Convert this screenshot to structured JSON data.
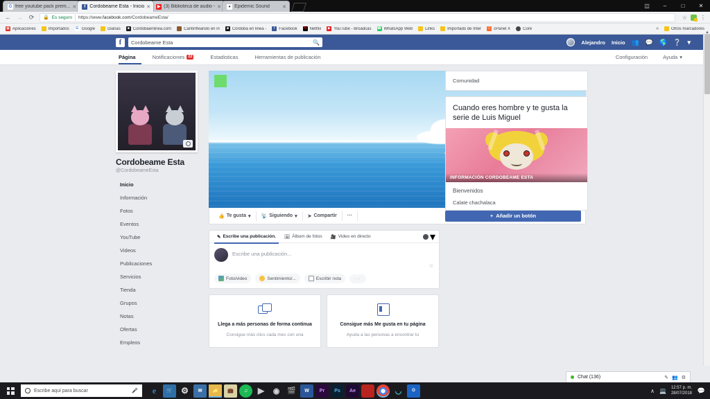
{
  "browser": {
    "tabs": [
      {
        "title": "free youtube pack prem...",
        "icon": "google-favicon",
        "active": false
      },
      {
        "title": "Cordobeame Esta - Inicio",
        "icon": "facebook-favicon",
        "active": true
      },
      {
        "title": "(3) Biblioteca de audio -",
        "icon": "youtube-favicon",
        "active": false
      },
      {
        "title": "Epidemic Sound",
        "icon": "epidemic-favicon",
        "active": false
      }
    ],
    "window_controls": [
      "minimize-restore",
      "minimize",
      "maximize",
      "close"
    ],
    "omnibox": {
      "secure_label": "Es seguro",
      "url_scheme": "https://www.",
      "url_host": "facebook.com",
      "url_path": "/CordobeameEsta/"
    },
    "bookmarks": [
      {
        "label": "Aplicaciones",
        "icon": "apps-grid-icon"
      },
      {
        "label": "Importados",
        "icon": "folder-icon"
      },
      {
        "label": "Google",
        "icon": "google-icon"
      },
      {
        "label": "Dianas",
        "icon": "folder-icon"
      },
      {
        "label": "Cordobaenlinea.com",
        "icon": "site-icon"
      },
      {
        "label": "Cantinfleando en in",
        "icon": "site-icon"
      },
      {
        "label": "Córdoba en linea -",
        "icon": "site-icon"
      },
      {
        "label": "Facebook",
        "icon": "facebook-icon"
      },
      {
        "label": "Netflix",
        "icon": "netflix-icon"
      },
      {
        "label": "YouTube - Broadcas",
        "icon": "youtube-icon"
      },
      {
        "label": "WhatsApp Web",
        "icon": "whatsapp-icon"
      },
      {
        "label": "Links",
        "icon": "folder-icon"
      },
      {
        "label": "Importado de Inter",
        "icon": "folder-icon"
      },
      {
        "label": "cPanel X",
        "icon": "cpanel-icon"
      },
      {
        "label": "Core",
        "icon": "core-icon"
      }
    ],
    "bookmarks_overflow": "»",
    "other_bookmarks": "Otros marcadores"
  },
  "facebook": {
    "topbar": {
      "logo": "f",
      "search_value": "Cordobeame Esta",
      "search_icon": "search-icon",
      "user_name": "Alejandro",
      "home_label": "Inicio",
      "icons": [
        "friend-requests-icon",
        "messenger-icon",
        "notifications-globe-icon",
        "help-icon",
        "account-chevron-icon"
      ]
    },
    "nav": {
      "items": [
        {
          "label": "Página",
          "active": true,
          "badge": null
        },
        {
          "label": "Notificaciones",
          "active": false,
          "badge": "22"
        },
        {
          "label": "Estadisticas",
          "active": false,
          "badge": null
        },
        {
          "label": "Herramientas de publicación",
          "active": false,
          "badge": null
        }
      ],
      "right_items": [
        {
          "label": "Configuración"
        },
        {
          "label": "Ayuda"
        }
      ]
    },
    "profile": {
      "page_name": "Cordobeame Esta",
      "handle": "@CordobeameEsta",
      "photo_camera_icon": "camera-icon"
    },
    "sidebar": [
      {
        "label": "Inicio",
        "active": true
      },
      {
        "label": "Información",
        "active": false
      },
      {
        "label": "Fotos",
        "active": false
      },
      {
        "label": "Eventos",
        "active": false
      },
      {
        "label": "YouTube",
        "active": false
      },
      {
        "label": "Videos",
        "active": false
      },
      {
        "label": "Publicaciones",
        "active": false
      },
      {
        "label": "Servicios",
        "active": false
      },
      {
        "label": "Tienda",
        "active": false
      },
      {
        "label": "Grupos",
        "active": false
      },
      {
        "label": "Notas",
        "active": false
      },
      {
        "label": "Ofertas",
        "active": false
      },
      {
        "label": "Empleos",
        "active": false
      }
    ],
    "actions": {
      "like": "Te gusta",
      "following": "Siguiendo",
      "share": "Compartir",
      "more": "···",
      "add_button": "Añadir un botón",
      "add_button_plus": "+"
    },
    "composer": {
      "tabs": [
        {
          "label": "Escribe una publicación.",
          "icon": "pencil-icon",
          "active": true
        },
        {
          "label": "Álbum de fotos",
          "icon": "photo-album-icon",
          "active": false
        },
        {
          "label": "Video en directo",
          "icon": "video-camera-icon",
          "active": false
        }
      ],
      "audience_icon": "globe-icon",
      "audience_chevron": "▾",
      "placeholder": "Escribe una publicación...",
      "emoji_icon": "emoji-icon",
      "actions": [
        {
          "label": "Foto/video",
          "icon": "photo-video-icon"
        },
        {
          "label": "Sentimiento/...",
          "icon": "feeling-icon"
        },
        {
          "label": "Escribir nota",
          "icon": "note-icon"
        },
        {
          "label": "···",
          "icon": "more-icon"
        }
      ]
    },
    "promos": [
      {
        "title": "Llega a más personas de forma continua",
        "desc": "Consigue más clics cada mes con una",
        "icon": "overlapping-squares-icon"
      },
      {
        "title": "Consigue más Me gusta en tu página",
        "desc": "Ayuda a las personas a encontrar tu",
        "icon": "page-layout-icon"
      }
    ],
    "right": {
      "community_title": "Comunidad",
      "post_title": "Cuando eres hombre y te gusta la serie de Luis Miguel",
      "post_image_caption": "INFORMACIÓN CORDOBEAME ESTA",
      "welcome": "Bienvenidos",
      "sub": "Calate chachalaca"
    },
    "chatbar": {
      "label": "Chat (136)",
      "icons": [
        "compose-icon",
        "friends-icon",
        "gear-icon"
      ]
    }
  },
  "taskbar": {
    "start_icon": "windows-start-icon",
    "search_placeholder": "Escribe aquí para buscar",
    "search_circle_icon": "cortana-circle-icon",
    "mic_icon": "microphone-icon",
    "apps": [
      {
        "name": "edge-icon",
        "glyph": "e",
        "cls": "a-edge"
      },
      {
        "name": "store-icon",
        "glyph": "",
        "cls": "a-store"
      },
      {
        "name": "settings-gear-icon",
        "glyph": "⚙",
        "cls": "a-set"
      },
      {
        "name": "mail-icon",
        "glyph": "",
        "cls": "a-mail"
      },
      {
        "name": "file-explorer-icon",
        "glyph": "",
        "cls": "a-expl"
      },
      {
        "name": "shopping-bag-icon",
        "glyph": "",
        "cls": "a-bag"
      },
      {
        "name": "spotify-icon",
        "glyph": "",
        "cls": "a-spot"
      },
      {
        "name": "media-player-icon",
        "glyph": "▶",
        "cls": "a-play"
      },
      {
        "name": "obs-studio-icon",
        "glyph": "◌",
        "cls": "a-obs"
      },
      {
        "name": "camtasia-icon",
        "glyph": "▰",
        "cls": "a-cam"
      },
      {
        "name": "word-icon",
        "glyph": "W",
        "cls": "a-w"
      },
      {
        "name": "premiere-icon",
        "glyph": "Pr",
        "cls": "a-pr"
      },
      {
        "name": "photoshop-icon",
        "glyph": "Ps",
        "cls": "a-ps"
      },
      {
        "name": "after-effects-icon",
        "glyph": "Ae",
        "cls": "a-ae"
      },
      {
        "name": "red-app-icon",
        "glyph": "",
        "cls": "a-red"
      },
      {
        "name": "chrome-icon",
        "glyph": "",
        "cls": "a-chrome"
      },
      {
        "name": "teal-app-icon",
        "glyph": "◧",
        "cls": "a-teal"
      },
      {
        "name": "outlook-icon",
        "glyph": "O⃣",
        "cls": "a-ob"
      }
    ],
    "tray": {
      "chevron": "∧",
      "network_icon": "network-icon",
      "time": "12:57 p. m.",
      "date": "28/07/2018",
      "action_center_icon": "action-center-icon"
    }
  }
}
